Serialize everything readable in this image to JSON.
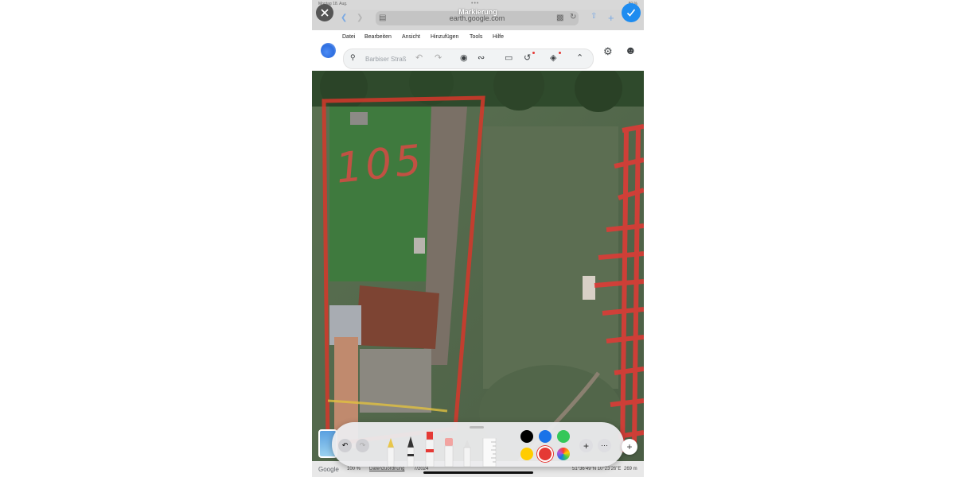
{
  "status_bar": {
    "date": "Montag 18. Aug.",
    "battery": "80 %"
  },
  "browser": {
    "markup_title": "Markierung",
    "url": "earth.google.com"
  },
  "menu": [
    "Datei",
    "Bearbeiten",
    "Ansicht",
    "Hinzufügen",
    "Tools",
    "Hilfe"
  ],
  "search": {
    "placeholder": "Barbiser Straße"
  },
  "map": {
    "drawn_label": "105"
  },
  "info_bar": {
    "brand": "Google",
    "zoom": "100 %",
    "data_link": "Datenzuordnung",
    "year": "7/2024",
    "coords": "51°36'49\"N 10°23'26\"E",
    "scale": "269 m"
  },
  "palette": {
    "colors": [
      "#000000",
      "#1a73e8",
      "#34c759",
      "#ffcc00",
      "#e53935"
    ],
    "selected_color": "#e53935",
    "tools": [
      "pen",
      "marker",
      "highlighter",
      "eraser",
      "lasso",
      "ruler"
    ]
  }
}
